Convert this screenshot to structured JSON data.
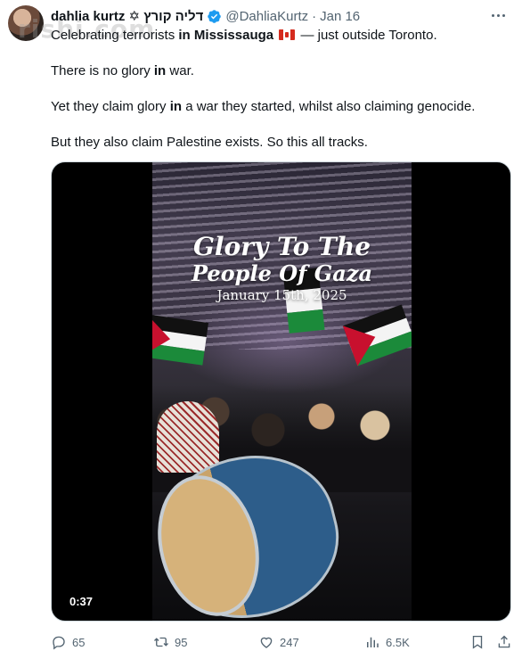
{
  "header": {
    "display_name": "dahlia kurtz ✡ דליה קורץ",
    "handle": "@DahliaKurtz",
    "separator": "·",
    "date": "Jan 16"
  },
  "watermark": "rishi.com",
  "tweet": {
    "line1_before": "Celebrating terrorists ",
    "line1_in": "in",
    "line1_place": "Mississauga",
    "line1_after": " — just outside Toronto.",
    "p2_before": "There is no glory ",
    "p2_in": "in",
    "p2_after": " war.",
    "p3_before": "Yet they claim glory ",
    "p3_in": "in",
    "p3_after": " a war they started, whilst also claiming genocide.",
    "p4": "But they also claim Palestine exists. So this all tracks."
  },
  "video": {
    "overlay_line1": "Glory To The",
    "overlay_line2": "People Of Gaza",
    "overlay_date": "January 15th, 2025",
    "duration": "0:37"
  },
  "actions": {
    "replies": "65",
    "reposts": "95",
    "likes": "247",
    "views": "6.5K"
  },
  "colors": {
    "text_primary": "#0f1419",
    "text_secondary": "#536471",
    "verified_blue": "#1d9bf0"
  },
  "icons": [
    "verified-badge-icon",
    "more-icon",
    "canada-flag-icon",
    "reply-icon",
    "retweet-icon",
    "like-icon",
    "views-icon",
    "bookmark-icon",
    "share-icon"
  ]
}
